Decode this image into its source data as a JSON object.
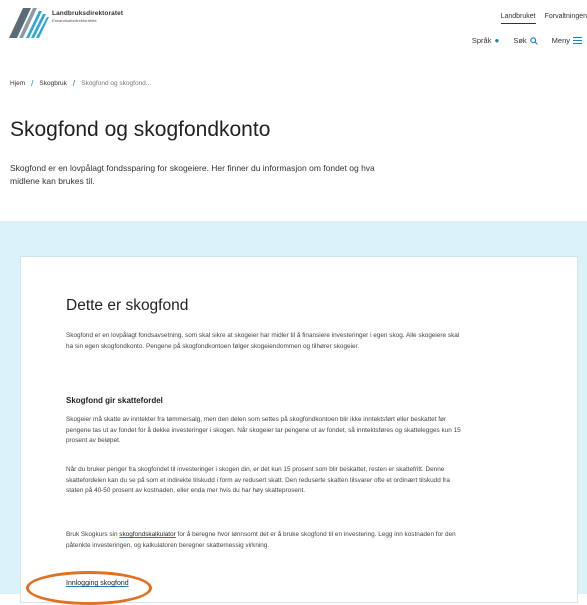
{
  "header": {
    "logo_name": "Landbruksdirektoratet",
    "logo_sub": "Eanandoallodirektoráhtta",
    "tabs": [
      "Landbruket",
      "Forvaltningen"
    ],
    "active_tab": 0,
    "utility": {
      "language": "Språk",
      "search": "Søk",
      "menu": "Meny"
    }
  },
  "breadcrumb": {
    "home": "Hjem",
    "section": "Skogbruk",
    "current": "Skogfond og skogfond..."
  },
  "page": {
    "title": "Skogfond og skogfondkonto",
    "intro": "Skogfond er en lovpålagt fondssparing for skogeiere. Her finner du informasjon om fondet og hva midlene kan brukes til."
  },
  "article": {
    "heading": "Dette er skogfond",
    "p1": "Skogfond er en lovpålagt fondsavsetning, som skal sikre at skogeier har midler til å finansiere investeringer i egen skog. Alle skogeiere skal ha sin egen skogfondkonto. Pengene på skogfondkontoen følger skogeiendommen og tilhører skogeier.",
    "subheading": "Skogfond gir skattefordel",
    "p2": "Skogeier må skatte av inntekter fra tømmersalg, men den delen som settes på skogfondkontoen blir ikke inntektsført eller beskattet før pengene tas ut av fondet for å dekke investeringer i skogen. Når skogeier tar pengene ut av fondet, så inntektsføres og skattelegges kun 15 prosent av beløpet.",
    "p3": "Når du bruker penger fra skogfondet til investeringer i skogen din, er det kun 15 prosent som blir beskattet, resten er skattefritt. Denne skattefordelen kan du se på som et indirekte tilskudd i form av redusert skatt. Den reduserte skatten tilsvarer ofte et ordinært tilskudd fra staten på 40-50 prosent av kostnaden, eller enda mer hvis du har høy skatteprosent.",
    "p4_before": "Bruk Skogkurs sin ",
    "p4_link": "skogfondskalkulator",
    "p4_after": " for å beregne hvor lønnsomt det er å bruke skogfond til en investering. Legg inn kostnaden for den påtenkte investeringen, og kalkulatoren beregner skattemessig virkning.",
    "login_link": "Innlogging skogfond"
  },
  "colors": {
    "accent": "#1f7fb8",
    "band": "#daf1f7",
    "highlight": "#e2701f"
  }
}
